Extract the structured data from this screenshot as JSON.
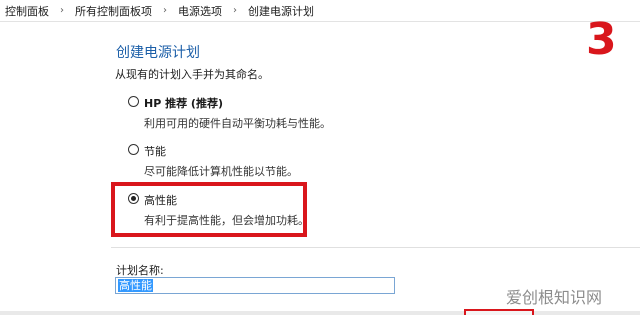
{
  "breadcrumb": {
    "items": [
      "控制面板",
      "所有控制面板项",
      "电源选项",
      "创建电源计划"
    ],
    "separator": "›"
  },
  "step_marker": "3",
  "page": {
    "title": "创建电源计划",
    "subtitle": "从现有的计划入手并为其命名。"
  },
  "plans": [
    {
      "label": "HP 推荐 (推荐)",
      "description": "利用可用的硬件自动平衡功耗与性能。",
      "selected": false
    },
    {
      "label": "节能",
      "description": "尽可能降低计算机性能以节能。",
      "selected": false
    },
    {
      "label": "高性能",
      "description": "有利于提高性能，但会增加功耗。",
      "selected": true
    }
  ],
  "plan_name": {
    "label": "计划名称:",
    "value": "高性能"
  },
  "watermark": "爱创根知识网",
  "colors": {
    "accent_red": "#d9161c",
    "title_blue": "#1c5fa8",
    "selection_blue": "#3399ff"
  }
}
